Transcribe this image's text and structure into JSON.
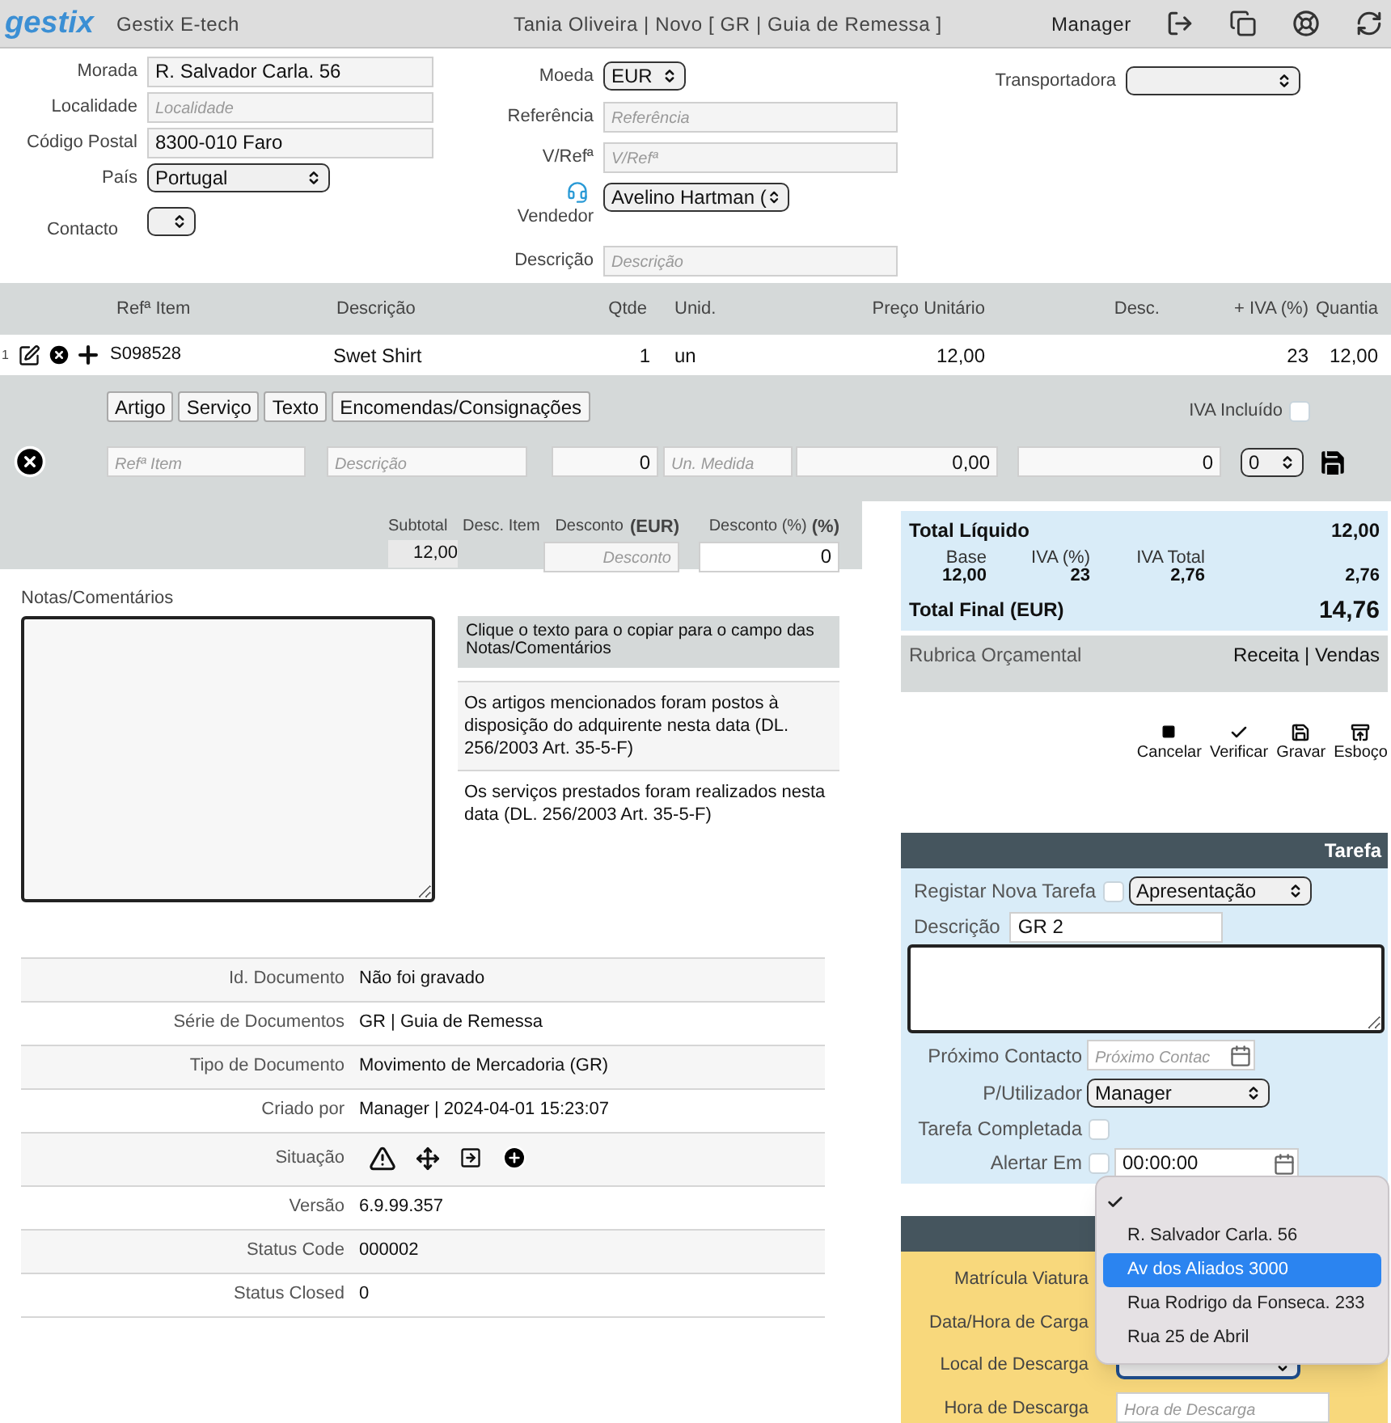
{
  "header": {
    "logo": "gestix",
    "app_name": "Gestix E-tech",
    "title": "Tania Oliveira | Novo [ GR | Guia de Remessa ]",
    "user": "Manager"
  },
  "form": {
    "columns": [
      [
        {
          "label": "Morada",
          "kind": "input",
          "value": "R. Salvador Carla. 56"
        },
        {
          "label": "Localidade",
          "kind": "input",
          "placeholder": "Localidade"
        },
        {
          "label": "Código Postal",
          "kind": "input",
          "value": "8300-010 Faro"
        },
        {
          "label": "País",
          "kind": "select",
          "value": "Portugal"
        },
        {
          "label": "Contacto",
          "kind": "select"
        }
      ],
      [
        {
          "label": "Moeda",
          "kind": "select",
          "value": "EUR"
        },
        {
          "label": "Referência",
          "kind": "input",
          "placeholder": "Referência"
        },
        {
          "label": "V/Refª",
          "kind": "input",
          "placeholder": "V/Refª"
        },
        {
          "label": "Vendedor",
          "kind": "agent_select",
          "value": "Avelino Hartman ("
        },
        {
          "label": "Descrição",
          "kind": "input",
          "placeholder": "Descrição"
        }
      ],
      [
        {
          "label": "Transportadora",
          "kind": "select"
        }
      ]
    ]
  },
  "items": {
    "columns": [
      "Refª Item",
      "Descrição",
      "Qtde",
      "Unid.",
      "Preço Unitário",
      "Desc.",
      "+ IVA (%)",
      "Quantia"
    ],
    "rows": [
      {
        "index": "1",
        "ref": "S098528",
        "description": "Swet Shirt",
        "qty": "1",
        "unit": "un",
        "unit_price": "12,00",
        "vat": "23",
        "amount": "12,00"
      }
    ]
  },
  "new_item": {
    "types": [
      "Artigo",
      "Serviço",
      "Texto",
      "Encomendas/Consignações"
    ],
    "vat_included_label": "IVA Incluído",
    "vat_included": false,
    "fields": [
      {
        "kind": "input",
        "placeholder": "Refª Item"
      },
      {
        "kind": "input",
        "placeholder": "Descrição"
      },
      {
        "kind": "input",
        "value": "0"
      },
      {
        "kind": "input",
        "placeholder": "Un. Medida"
      },
      {
        "kind": "input",
        "value": "0,00"
      },
      {
        "kind": "input",
        "value": "0"
      },
      {
        "kind": "select",
        "value": "0"
      }
    ]
  },
  "discounts": {
    "subtotal_label": "Subtotal",
    "subtotal": "12,00",
    "item_discount_label": "Desc. Item",
    "discount_label": "Desconto",
    "discount_unit": "(EUR)",
    "discount_placeholder": "Desconto",
    "discount_pct_label": "Desconto (%)",
    "discount_pct_unit": "(%)",
    "discount_pct": "0"
  },
  "notes": {
    "label": "Notas/Comentários",
    "hint": "Clique o texto para o copiar para o campo das Notas/Comentários",
    "snippets": [
      {
        "text": "Os artigos mencionados foram postos à disposição do adquirente nesta data (DL. 256/2003 Art. 35-5-F)",
        "highlighted": true
      },
      {
        "text": "Os serviços prestados foram realizados nesta data (DL. 256/2003 Art. 35-5-F)",
        "highlighted": false
      }
    ]
  },
  "document_info": [
    {
      "kind": "text",
      "label": "Id. Documento",
      "value": "Não foi gravado"
    },
    {
      "kind": "text",
      "label": "Série de Documentos",
      "value": "GR | Guia de Remessa"
    },
    {
      "kind": "text",
      "label": "Tipo de Documento",
      "value": "Movimento de Mercadoria (GR)"
    },
    {
      "kind": "text",
      "label": "Criado por",
      "value": "Manager | 2024-04-01 15:23:07"
    },
    {
      "kind": "icons",
      "label": "Situação"
    },
    {
      "kind": "text",
      "label": "Versão",
      "value": "6.9.99.357"
    },
    {
      "kind": "text",
      "label": "Status Code",
      "value": "000002"
    },
    {
      "kind": "text",
      "label": "Status Closed",
      "value": "0"
    }
  ],
  "totals": {
    "net_label": "Total Líquido",
    "net": "12,00",
    "tax_columns": [
      {
        "label": "Base",
        "value": "12,00"
      },
      {
        "label": "IVA (%)",
        "value": "23"
      },
      {
        "label": "IVA Total",
        "value": "2,76"
      }
    ],
    "tax_sum": "2,76",
    "final_label": "Total Final (EUR)",
    "final": "14,76"
  },
  "budget": {
    "label": "Rubrica Orçamental",
    "value": "Receita | Vendas"
  },
  "actions": [
    {
      "kind": "cancel",
      "label": "Cancelar"
    },
    {
      "kind": "verify",
      "label": "Verificar"
    },
    {
      "kind": "save",
      "label": "Gravar"
    },
    {
      "kind": "draft",
      "label": "Esboço"
    }
  ],
  "task": {
    "title": "Tarefa",
    "register_label": "Registar Nova Tarefa",
    "register": false,
    "type": "Apresentação",
    "description_label": "Descrição",
    "description": "GR 2",
    "next_contact_label": "Próximo Contacto",
    "next_contact_placeholder": "Próximo Contac",
    "user_label": "P/Utilizador",
    "user": "Manager",
    "completed_label": "Tarefa Completada",
    "completed": false,
    "alert_label": "Alertar Em",
    "alert": false,
    "alert_time": "00:00:00"
  },
  "transport": {
    "fields": [
      {
        "kind": "label_only",
        "label": "Matrícula Viatura"
      },
      {
        "kind": "label_only",
        "label": "Data/Hora de Carga"
      },
      {
        "kind": "select",
        "label": "Local de Descarga",
        "focused": true
      },
      {
        "kind": "input",
        "label": "Hora de Descarga",
        "placeholder": "Hora de Descarga"
      }
    ]
  },
  "address_menu": {
    "options": [
      {
        "checked": true,
        "highlighted": false
      },
      {
        "label": "R. Salvador Carla. 56",
        "checked": false,
        "highlighted": false
      },
      {
        "label": "Av dos Aliados 3000",
        "checked": false,
        "highlighted": true
      },
      {
        "label": "Rua Rodrigo da Fonseca. 233",
        "checked": false,
        "highlighted": false
      },
      {
        "label": "Rua 25 de Abril",
        "checked": false,
        "highlighted": false
      }
    ]
  }
}
